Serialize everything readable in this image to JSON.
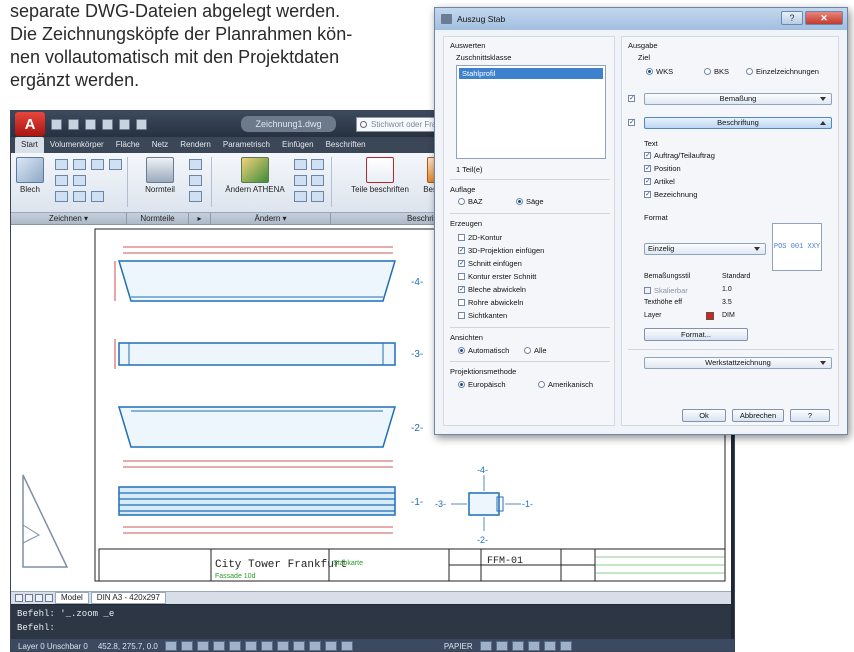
{
  "intro": {
    "lines": [
      "separate DWG-Dateien abgelegt werden.",
      "Die Zeichnungsköpfe der Planrahmen kön-",
      "nen vollautomatisch mit den Projektdaten",
      "ergänzt werden."
    ]
  },
  "acad": {
    "app_letter": "A",
    "title": "Zeichnung1.dwg",
    "search_placeholder": "Stichwort oder Frage",
    "menu": [
      "Start",
      "Volumenkörper",
      "Fläche",
      "Netz",
      "Rendern",
      "Parametrisch",
      "Einfügen",
      "Beschriften"
    ],
    "ribbon": {
      "blech": "Blech",
      "normteil": "Normteil",
      "aendern_athena": "Ändern ATHENA",
      "teile_beschriften": "Teile beschriften",
      "beschriftu": "Beschriftu"
    },
    "panels": [
      "Zeichnen ▾",
      "Normteile",
      "▸",
      "Ändern ▾",
      "Beschriften"
    ],
    "drawing": {
      "title_block_name": "City Tower Frankfurt",
      "title_block_sub": "Fassade 10d",
      "stab_label": "Stabkarte",
      "drawing_no": "FFM-01",
      "part_labels": [
        "-4-",
        "-3-",
        "-2-",
        "-1-"
      ]
    },
    "layout_tabs": [
      "Model",
      "DIN A3 - 420x297"
    ],
    "command_lines": [
      "Befehl: '_.zoom _e",
      "Befehl:"
    ],
    "status": {
      "layer": "Layer 0 Unschbar 0",
      "coords": "452.8, 275.7, 0.0",
      "papier": "PAPIER"
    }
  },
  "dialog": {
    "title": "Auszug Stab",
    "close_label": "✕",
    "auswerten": {
      "heading": "Auswerten",
      "zuschnittsklasse_label": "Zuschnittsklasse",
      "list_items": [
        "Stahlprofil"
      ],
      "count_label": "1 Teil(e)"
    },
    "auflage": {
      "heading": "Auflage",
      "options": [
        "BAZ",
        "Säge"
      ],
      "selected": "Säge"
    },
    "erzeugen": {
      "heading": "Erzeugen",
      "items": [
        {
          "label": "2D-Kontur",
          "checked": false
        },
        {
          "label": "3D-Projektion einfügen",
          "checked": true
        },
        {
          "label": "Schnitt einfügen",
          "checked": true
        },
        {
          "label": "Kontur erster Schnitt",
          "checked": false
        },
        {
          "label": "Bleche abwickeln",
          "checked": true
        },
        {
          "label": "Rohre abwickeln",
          "checked": false
        },
        {
          "label": "Sichtkanten",
          "checked": false
        }
      ]
    },
    "ansichten": {
      "heading": "Ansichten",
      "options": [
        "Automatisch",
        "Alle"
      ],
      "selected": "Automatisch"
    },
    "projektionsmethode": {
      "heading": "Projektionsmethode",
      "options": [
        "Europäisch",
        "Amerikanisch"
      ],
      "selected": "Europäisch"
    },
    "ausgabe": {
      "heading": "Ausgabe",
      "ziel_label": "Ziel",
      "ziel_options": [
        "WKS",
        "BKS",
        "Einzelzeichnungen"
      ],
      "ziel_selected": "WKS",
      "bemassung": "Bemaßung",
      "beschriftung": "Beschriftung",
      "text_label": "Text",
      "text_items": [
        {
          "label": "Auftrag/Teilauftrag",
          "checked": true
        },
        {
          "label": "Position",
          "checked": true
        },
        {
          "label": "Artikel",
          "checked": true
        },
        {
          "label": "Bezeichnung",
          "checked": true
        }
      ],
      "format_label": "Format",
      "format_value": "Einzelig",
      "preview_text": "POS 001 XXY",
      "props": [
        {
          "key": "Bemaßungsstil",
          "value": "Standard"
        },
        {
          "key": "Skalierbar",
          "value": "1.0"
        },
        {
          "key": "Texthöhe eff",
          "value": "3.5"
        },
        {
          "key": "Layer",
          "value": "DIM"
        }
      ],
      "format_button": "Format...",
      "werkstatt": "Werkstattzeichnung"
    },
    "buttons": {
      "ok": "Ok",
      "cancel": "Abbrechen",
      "help": "?"
    }
  }
}
